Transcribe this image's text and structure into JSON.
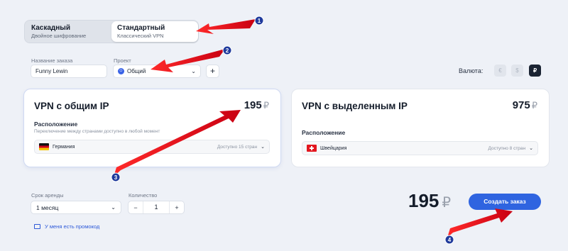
{
  "tabs": [
    {
      "title": "Каскадный",
      "subtitle": "Двойное шифрование"
    },
    {
      "title": "Стандартный",
      "subtitle": "Классический VPN"
    }
  ],
  "form": {
    "name_label": "Название заказа",
    "name_value": "Funny Lewin",
    "project_label": "Проект",
    "project_value": "Общий",
    "project_icon": "project-icon",
    "add_label": "+"
  },
  "currency": {
    "label": "Валюта:",
    "options": [
      "€",
      "$",
      "₽"
    ],
    "selected": "₽"
  },
  "cards": [
    {
      "title": "VPN с общим IP",
      "price": "195",
      "currency": "₽",
      "location_label": "Расположение",
      "location_hint": "Переключение между странами доступно в любой момент",
      "country": "Германия",
      "available": "Доступно 15 стран"
    },
    {
      "title": "VPN с выделенным IP",
      "price": "975",
      "currency": "₽",
      "location_label": "Расположение",
      "country": "Швейцария",
      "available": "Доступно 8 стран"
    }
  ],
  "period": {
    "label": "Срок аренды",
    "value": "1 месяц"
  },
  "quantity": {
    "label": "Количество",
    "value": "1",
    "minus": "−",
    "plus": "+"
  },
  "promo_text": "У меня есть промокод",
  "total": {
    "amount": "195",
    "currency": "₽"
  },
  "order_button": "Создать заказ",
  "markers": [
    "1",
    "2",
    "3",
    "4"
  ],
  "colors": {
    "accent": "#2f64e0",
    "arrow": "#e3101c",
    "marker": "#1f3a9c"
  }
}
